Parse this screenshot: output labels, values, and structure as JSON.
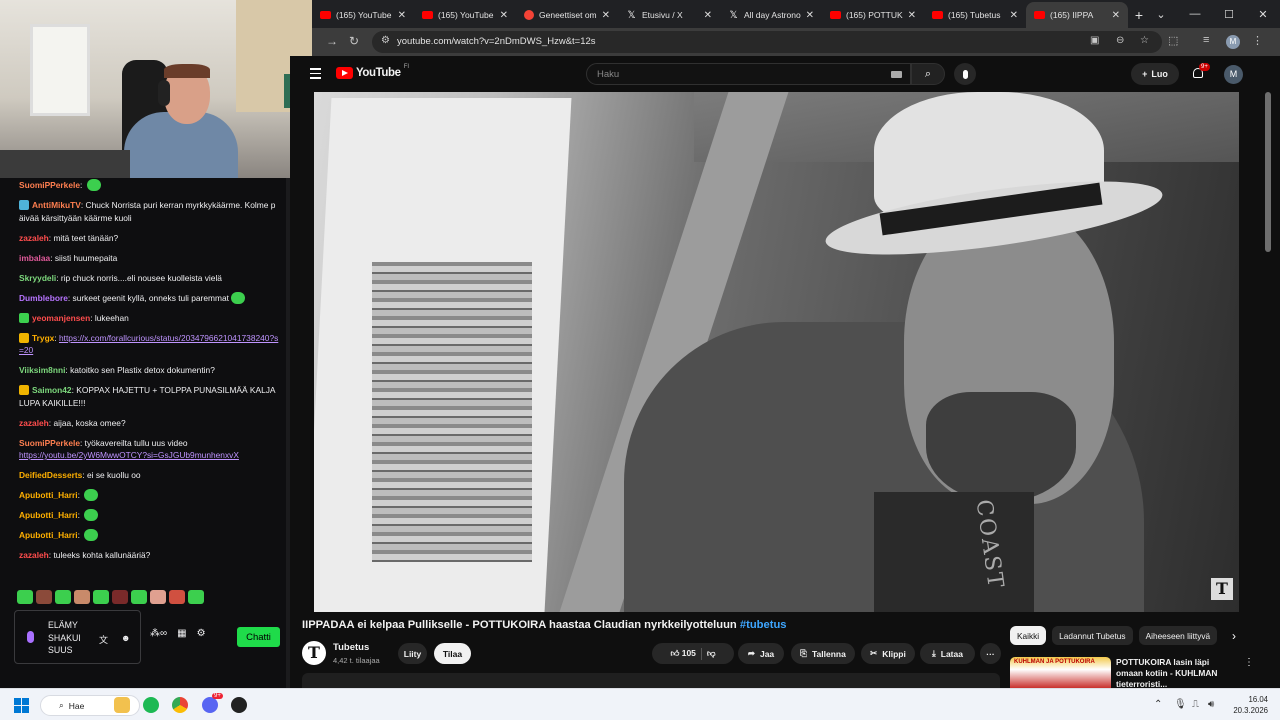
{
  "browser": {
    "tabs": [
      {
        "title": "(165) YouTube",
        "icon": "youtube-icon",
        "active": false
      },
      {
        "title": "(165) YouTube",
        "icon": "youtube-icon",
        "active": false
      },
      {
        "title": "Geneettiset om",
        "icon": "gemini-icon",
        "active": false
      },
      {
        "title": "Etusivu / X",
        "icon": "x-icon",
        "active": false
      },
      {
        "title": "All day Astrono",
        "icon": "x-icon",
        "active": false
      },
      {
        "title": "(165) POTTUK",
        "icon": "youtube-icon",
        "active": false
      },
      {
        "title": "(165) Tubetus",
        "icon": "youtube-icon",
        "active": false
      },
      {
        "title": "(165) IIPPA",
        "icon": "youtube-icon",
        "active": true
      }
    ],
    "url": "youtube.com/watch?v=2nDmDWS_Hzw&t=12s",
    "profile_initial": "M"
  },
  "webcam": {
    "description_icon": "webcam-feed"
  },
  "chat": {
    "messages": [
      {
        "user": "SuomiPPerkele",
        "user_color": "#ff7f50",
        "badge": "",
        "text": "",
        "emote": true
      },
      {
        "user": "AnttiMikuTV",
        "user_color": "#ff7f50",
        "badge": "blue",
        "text": "Chuck Norrista puri kerran myrkkykäärme. Kolme päivää kärsittyään käärme kuoli",
        "emote": false
      },
      {
        "user": "zazaleh",
        "user_color": "#ff4d4d",
        "badge": "",
        "text": "mitä teet tänään?",
        "emote": false
      },
      {
        "user": "imbalaa",
        "user_color": "#e05a9a",
        "badge": "",
        "text": "siisti huumepaita",
        "emote": false
      },
      {
        "user": "Skryydeli",
        "user_color": "#7dd87d",
        "badge": "",
        "text": "rip chuck norris....eli nousee kuolleista vielä",
        "emote": false
      },
      {
        "user": "Dumblebore",
        "user_color": "#b774ff",
        "badge": "",
        "text": "surkeet geenit kyllä, onneks tuli paremmat",
        "emote": true
      },
      {
        "user": "yeomanjensen",
        "user_color": "#ff4d4d",
        "badge": "green",
        "text": "lukeehan",
        "emote": false
      },
      {
        "user": "Trygx",
        "user_color": "#ffb000",
        "badge": "gold",
        "text": "",
        "link": "https://x.com/forallcurious/status/2034796621041738240?s=20",
        "emote": false
      },
      {
        "user": "Viiksim8nni",
        "user_color": "#7dd87d",
        "badge": "",
        "text": "katoitko sen Plastix detox dokumentin?",
        "emote": false
      },
      {
        "user": "Saimon42",
        "user_color": "#7dd87d",
        "badge": "gold",
        "text": "KOPPAX HAJETTU + TOLPPA PUNASILMÄÄ KALJALUPA KAIKILLE!!!",
        "emote": false
      },
      {
        "user": "zazaleh",
        "user_color": "#ff4d4d",
        "badge": "",
        "text": "aijaa, koska omee?",
        "emote": false
      },
      {
        "user": "SuomiPPerkele",
        "user_color": "#ff7f50",
        "badge": "",
        "text": "työkavereilta tullu uus video",
        "link": "https://youtu.be/2yW6MwwOTCY?si=GsJGUb9munhenxvX",
        "emote": false
      },
      {
        "user": "DeifiedDesserts",
        "user_color": "#ffb000",
        "badge": "",
        "text": "ei se kuollu oo",
        "emote": false
      },
      {
        "user": "Apubotti_Harri",
        "user_color": "#ffb000",
        "badge": "",
        "text": "",
        "emote": true
      },
      {
        "user": "Apubotti_Harri",
        "user_color": "#ffb000",
        "badge": "",
        "text": "",
        "emote": true
      },
      {
        "user": "Apubotti_Harri",
        "user_color": "#ffb000",
        "badge": "",
        "text": "",
        "emote": true
      },
      {
        "user": "zazaleh",
        "user_color": "#ff4d4d",
        "badge": "",
        "text": "tuleeks kohta kallunääriä?",
        "emote": false
      }
    ],
    "input_text": "ELÄMY SHAKUI SUUS",
    "send_label": "Chatti",
    "emote_colors": [
      "#3ccf4e",
      "#8b4a3a",
      "#3ccf4e",
      "#c98a6a",
      "#3ccf4e",
      "#7a2a2a",
      "#3ccf4e",
      "#e0a090",
      "#d05040",
      "#3ccf4e"
    ]
  },
  "youtube": {
    "logo_text": "YouTube",
    "logo_region": "FI",
    "search_placeholder": "Haku",
    "create_label": "Luo",
    "notif_count": "9+",
    "avatar_initial": "M",
    "video_title": "IIPPADAA ei kelpaa Pullikselle - POTTUKOIRA haastaa Claudian nyrkkeilyotteluun",
    "video_hashtag": "#tubetus",
    "shirt_text": "COAST",
    "watermark": "T",
    "channel": {
      "name": "Tubetus",
      "subs": "4,42 t. tilaajaa",
      "logo": "T"
    },
    "join_label": "Liity",
    "subscribe_label": "Tilaa",
    "like_count": "105",
    "share_label": "Jaa",
    "save_label": "Tallenna",
    "clip_label": "Klippi",
    "download_label": "Lataa",
    "more_label": "···",
    "chips": [
      {
        "label": "Kaikki",
        "selected": true
      },
      {
        "label": "Ladannut Tubetus",
        "selected": false
      },
      {
        "label": "Aiheeseen liittyvä",
        "selected": false
      }
    ],
    "rec_title": "POTTUKOIRA lasin läpi omaan kotiin - KUHLMAN tieterroristi...",
    "rec_thumb_text": "KUHLMAN JA POTTUKOIRA"
  },
  "taskbar": {
    "search_label": "Hae",
    "time": "16.04",
    "date": "20.3.2026",
    "discord_badge": "9+"
  }
}
